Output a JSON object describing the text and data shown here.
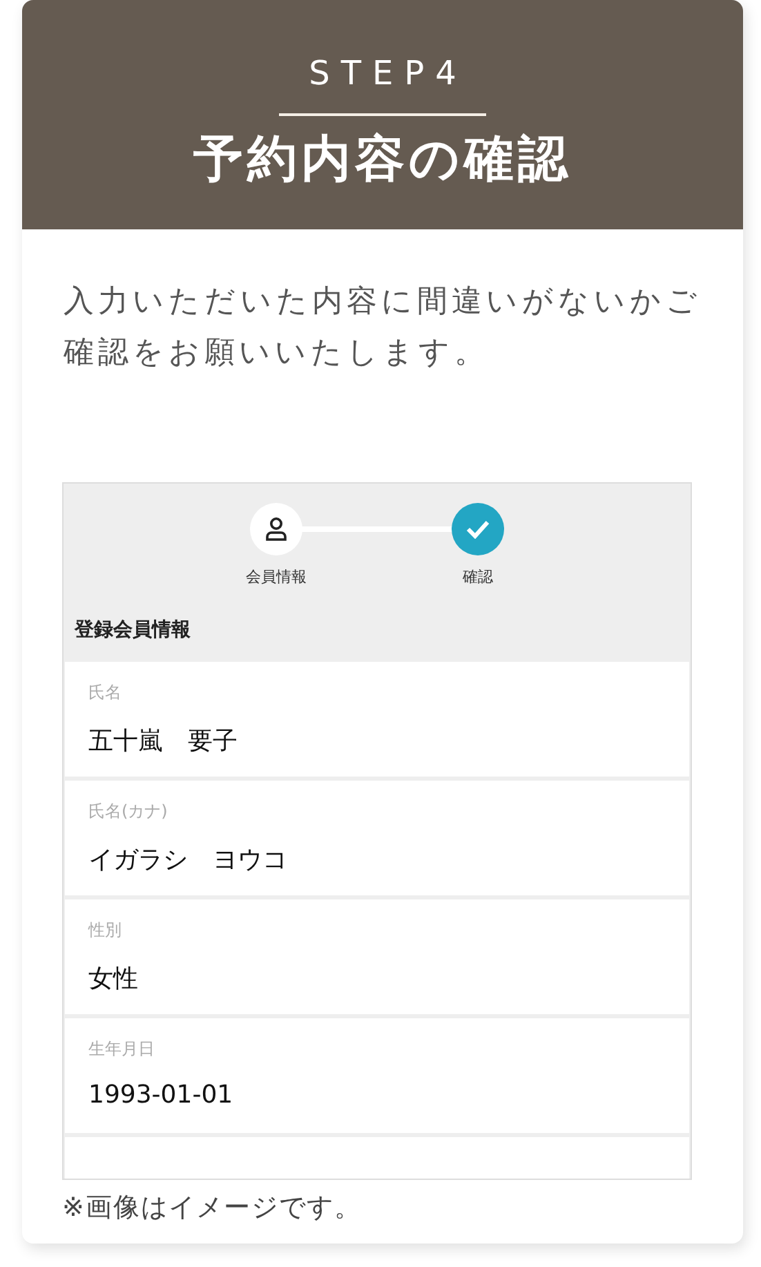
{
  "header": {
    "step": "STEP4",
    "title": "予約内容の確認"
  },
  "intro": "入力いただいた内容に間違いがないかご確認をお願いいたします。",
  "screen": {
    "steps": [
      {
        "label": "会員情報",
        "kind": "person",
        "selected": false
      },
      {
        "label": "確認",
        "kind": "check",
        "selected": true
      }
    ],
    "section_title": "登録会員情報",
    "fields": [
      {
        "label": "氏名",
        "value": "五十嵐　要子"
      },
      {
        "label": "氏名(カナ)",
        "value": "イガラシ　ヨウコ"
      },
      {
        "label": "性別",
        "value": "女性"
      },
      {
        "label": "生年月日",
        "value": "1993-01-01"
      }
    ]
  },
  "note": "※画像はイメージです。"
}
